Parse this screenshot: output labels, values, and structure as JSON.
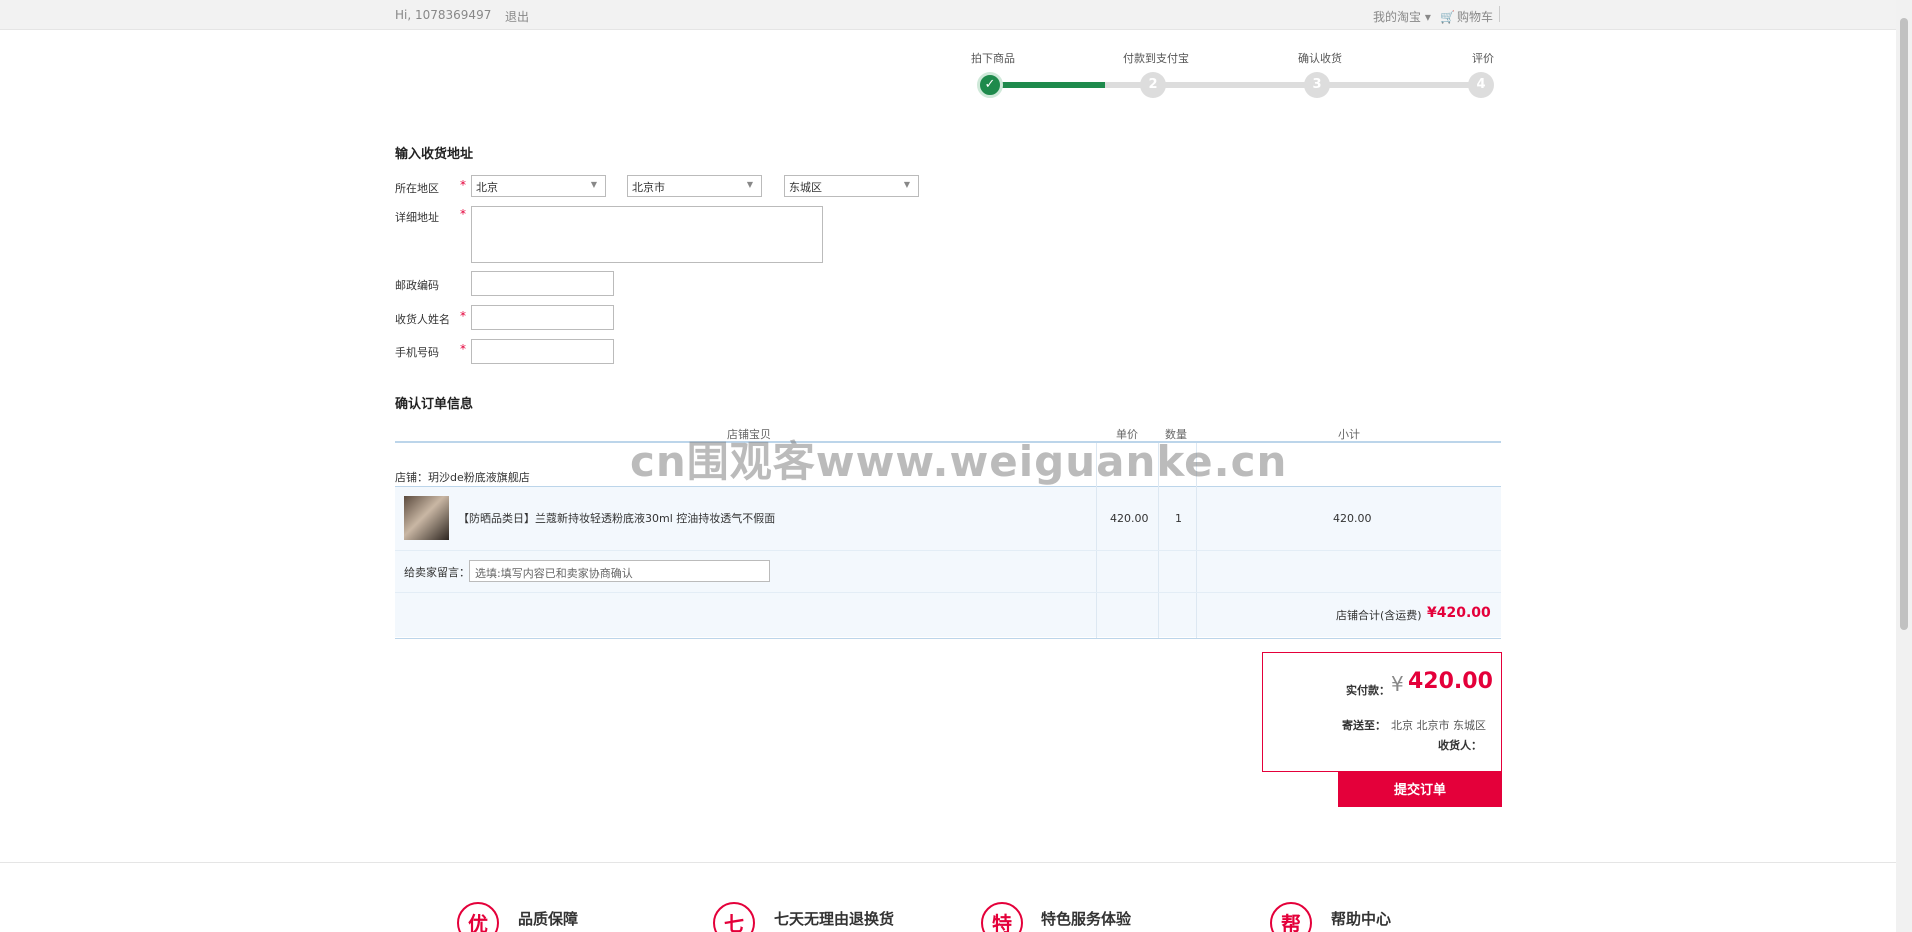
{
  "topbar": {
    "greeting": "Hi,  1078369497",
    "logout": "退出",
    "my_taobao": "我的淘宝 ▾",
    "cart": "购物车"
  },
  "steps": [
    {
      "label": "拍下商品",
      "num": "✓",
      "done": true
    },
    {
      "label": "付款到支付宝",
      "num": "2",
      "done": false
    },
    {
      "label": "确认收货",
      "num": "3",
      "done": false
    },
    {
      "label": "评价",
      "num": "4",
      "done": false
    }
  ],
  "address": {
    "title": "输入收货地址",
    "region_label": "所在地区",
    "province": "北京",
    "city": "北京市",
    "district": "东城区",
    "detail_label": "详细地址",
    "zip_label": "邮政编码",
    "name_label": "收货人姓名",
    "phone_label": "手机号码",
    "required_mark": "*"
  },
  "order": {
    "title": "确认订单信息",
    "col_goods": "店铺宝贝",
    "col_price": "单价",
    "col_qty": "数量",
    "col_subtotal": "小计",
    "shop_name": "店铺：玥沙de粉底液旗舰店",
    "item_name": "【防晒品类日】兰蔻新持妆轻透粉底液30ml 控油持妆透气不假面",
    "item_price": "420.00",
    "item_qty": "1",
    "item_subtotal": "420.00",
    "message_label": "给卖家留言：",
    "message_placeholder": "选填:填写内容已和卖家协商确认",
    "shop_total_label": "店铺合计(含运费)",
    "shop_total": "¥420.00"
  },
  "summary": {
    "paid_label": "实付款：",
    "currency": "¥",
    "paid_value": "420.00",
    "ship_label": "寄送至：",
    "ship_value": "北京 北京市 东城区",
    "receiver_label": "收货人：",
    "submit": "提交订单"
  },
  "footer": [
    {
      "icon": "优",
      "label": "品质保障"
    },
    {
      "icon": "七",
      "label": "七天无理由退换货"
    },
    {
      "icon": "特",
      "label": "特色服务体验"
    },
    {
      "icon": "帮",
      "label": "帮助中心"
    }
  ],
  "watermark": "cn围观客www.weiguanke.cn",
  "colors": {
    "accent": "#e4003a",
    "step_done": "#1e8a4c",
    "table_line": "#bcd5ea"
  }
}
